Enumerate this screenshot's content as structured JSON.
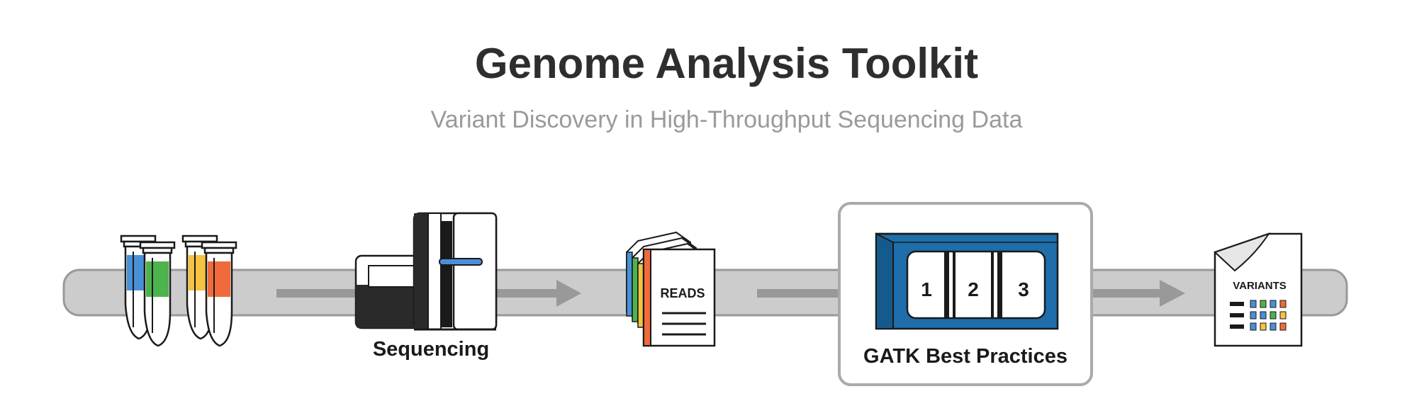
{
  "header": {
    "title": "Genome Analysis Toolkit",
    "subtitle": "Variant Discovery in High-Throughput Sequencing Data"
  },
  "pipeline": {
    "samples": {
      "tube_colors": [
        "#4a90d9",
        "#4db34d",
        "#f5c242",
        "#f06a3c"
      ]
    },
    "sequencing": {
      "label": "Sequencing"
    },
    "reads": {
      "label": "READS",
      "tab_colors": [
        "#4a90d9",
        "#4db34d",
        "#f5c242",
        "#f06a3c"
      ]
    },
    "gatk": {
      "label": "GATK Best Practices",
      "steps": [
        "1",
        "2",
        "3"
      ]
    },
    "variants": {
      "label": "VARIANTS",
      "grid_colors": [
        "#4a90d9",
        "#4db34d",
        "#f5c242",
        "#f06a3c"
      ]
    }
  },
  "colors": {
    "track": "#cccccc",
    "track_border": "#999999",
    "arrow": "#999999",
    "gatk_blue": "#1d6eaa",
    "gatk_blue_light": "#3aa0d6",
    "gatk_blue_dark": "#155a8c",
    "ink": "#1a1a1a"
  }
}
